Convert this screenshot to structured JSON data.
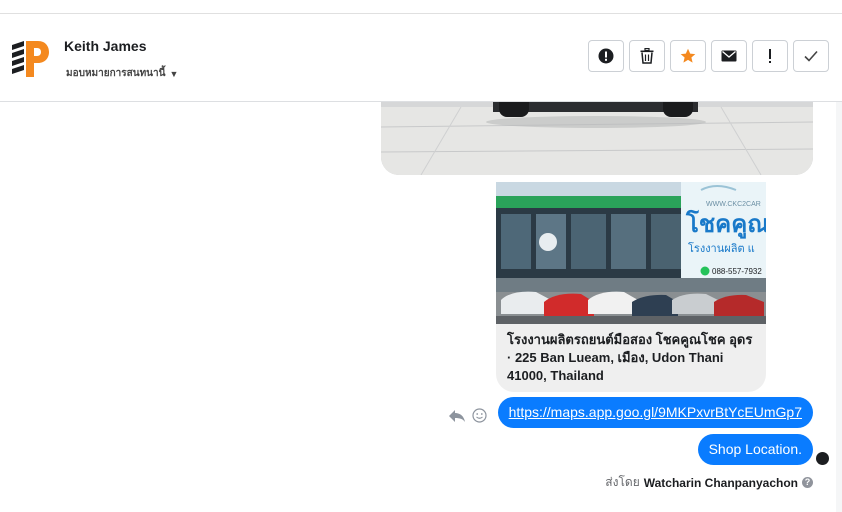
{
  "header": {
    "contact_name": "Keith James",
    "assign_label": "มอบหมายการสนทนานี้"
  },
  "icons": {
    "logo": "sp-logo",
    "actions": [
      "alert-circle-icon",
      "trash-icon",
      "star-icon",
      "envelope-icon",
      "exclamation-icon",
      "check-icon"
    ]
  },
  "colors": {
    "accent": "#0a7cff",
    "star": "#f4891f",
    "logo_orange": "#f4891f"
  },
  "thread": {
    "link_card": {
      "title": "โรงงานผลิตรถยนต์มือสอง โชคคูณโชค อุดร · 225 Ban Lueam, เมือง, Udon Thani 41000, Thailand",
      "thumb_brand": "โชคคูณ",
      "thumb_sub": "โรงงานผลิต แ",
      "thumb_phone": "088-557-7932",
      "thumb_url": "WWW.CKC2CAR"
    },
    "link_bubble": "https://maps.app.goo.gl/9MKPxvrBtYcEUmGp7",
    "shop_bubble": "Shop Location.",
    "sent_by_prefix": "ส่งโดย",
    "sent_by_name": "Watcharin Chanpanyachon"
  }
}
